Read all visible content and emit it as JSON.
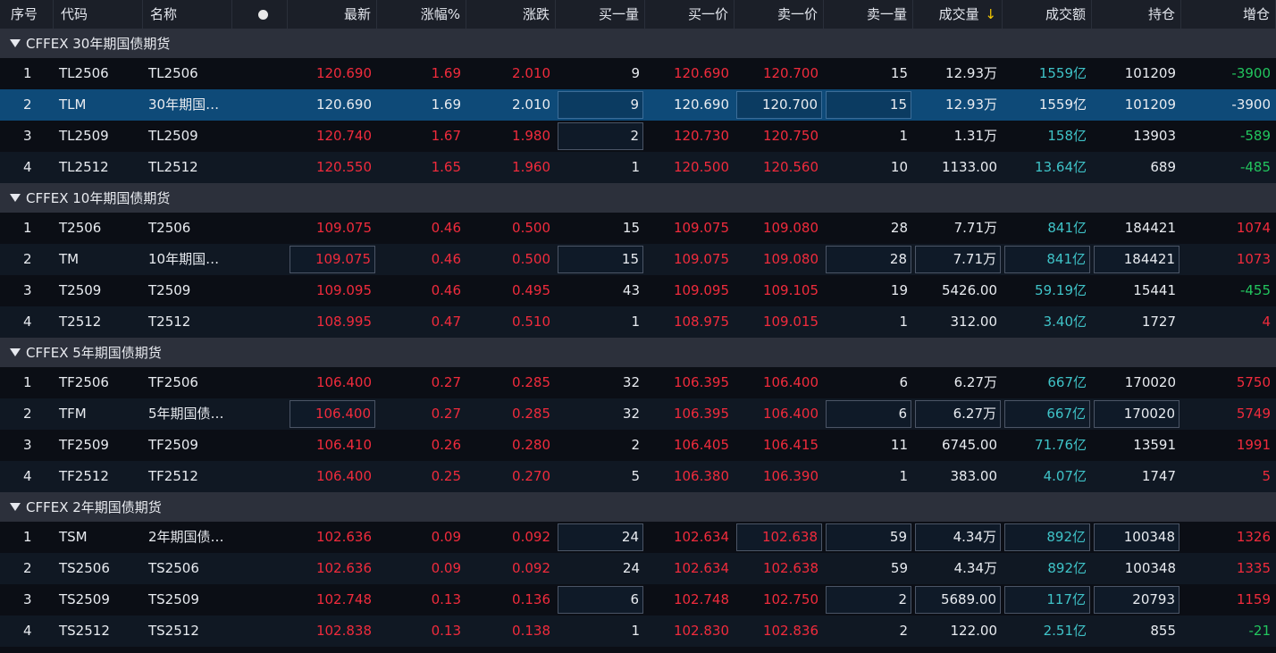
{
  "columns": [
    "序号",
    "代码",
    "名称",
    "",
    "最新",
    "涨幅%",
    "涨跌",
    "买一量",
    "买一价",
    "卖一价",
    "卖一量",
    "成交量",
    "成交额",
    "持仓",
    "增仓"
  ],
  "sort_indicator": "↓",
  "colors": {
    "up": "#f02b3c",
    "down": "#22c55e",
    "amount": "#3fc3c8",
    "selected": "#0e4a78"
  },
  "groups": [
    {
      "title": "CFFEX 30年期国债期货",
      "rows": [
        {
          "idx": "1",
          "code": "TL2506",
          "name": "TL2506",
          "last": "120.690",
          "pct": "1.69",
          "chg": "2.010",
          "bidv": "9",
          "bid": "120.690",
          "ask": "120.700",
          "askv": "15",
          "vol": "12.93万",
          "amt": "1559亿",
          "oi": "101209",
          "doi": "-3900",
          "doi_color": "green"
        },
        {
          "idx": "2",
          "code": "TLM",
          "name": "30年期国…",
          "last": "120.690",
          "pct": "1.69",
          "chg": "2.010",
          "bidv": "9",
          "bid": "120.690",
          "ask": "120.700",
          "askv": "15",
          "vol": "12.93万",
          "amt": "1559亿",
          "oi": "101209",
          "doi": "-3900",
          "doi_color": "white",
          "selected": true
        },
        {
          "idx": "3",
          "code": "TL2509",
          "name": "TL2509",
          "last": "120.740",
          "pct": "1.67",
          "chg": "1.980",
          "bidv": "2",
          "bid": "120.730",
          "ask": "120.750",
          "askv": "1",
          "vol": "1.31万",
          "amt": "158亿",
          "oi": "13903",
          "doi": "-589",
          "doi_color": "green"
        },
        {
          "idx": "4",
          "code": "TL2512",
          "name": "TL2512",
          "last": "120.550",
          "pct": "1.65",
          "chg": "1.960",
          "bidv": "1",
          "bid": "120.500",
          "ask": "120.560",
          "askv": "10",
          "vol": "1133.00",
          "amt": "13.64亿",
          "oi": "689",
          "doi": "-485",
          "doi_color": "green"
        }
      ]
    },
    {
      "title": "CFFEX 10年期国债期货",
      "rows": [
        {
          "idx": "1",
          "code": "T2506",
          "name": "T2506",
          "last": "109.075",
          "pct": "0.46",
          "chg": "0.500",
          "bidv": "15",
          "bid": "109.075",
          "ask": "109.080",
          "askv": "28",
          "vol": "7.71万",
          "amt": "841亿",
          "oi": "184421",
          "doi": "1074",
          "doi_color": "red"
        },
        {
          "idx": "2",
          "code": "TM",
          "name": "10年期国…",
          "last": "109.075",
          "pct": "0.46",
          "chg": "0.500",
          "bidv": "15",
          "bid": "109.075",
          "ask": "109.080",
          "askv": "28",
          "vol": "7.71万",
          "amt": "841亿",
          "oi": "184421",
          "doi": "1073",
          "doi_color": "red"
        },
        {
          "idx": "3",
          "code": "T2509",
          "name": "T2509",
          "last": "109.095",
          "pct": "0.46",
          "chg": "0.495",
          "bidv": "43",
          "bid": "109.095",
          "ask": "109.105",
          "askv": "19",
          "vol": "5426.00",
          "amt": "59.19亿",
          "oi": "15441",
          "doi": "-455",
          "doi_color": "green"
        },
        {
          "idx": "4",
          "code": "T2512",
          "name": "T2512",
          "last": "108.995",
          "pct": "0.47",
          "chg": "0.510",
          "bidv": "1",
          "bid": "108.975",
          "ask": "109.015",
          "askv": "1",
          "vol": "312.00",
          "amt": "3.40亿",
          "oi": "1727",
          "doi": "4",
          "doi_color": "red"
        }
      ]
    },
    {
      "title": "CFFEX 5年期国债期货",
      "rows": [
        {
          "idx": "1",
          "code": "TF2506",
          "name": "TF2506",
          "last": "106.400",
          "pct": "0.27",
          "chg": "0.285",
          "bidv": "32",
          "bid": "106.395",
          "ask": "106.400",
          "askv": "6",
          "vol": "6.27万",
          "amt": "667亿",
          "oi": "170020",
          "doi": "5750",
          "doi_color": "red"
        },
        {
          "idx": "2",
          "code": "TFM",
          "name": "5年期国债…",
          "last": "106.400",
          "pct": "0.27",
          "chg": "0.285",
          "bidv": "32",
          "bid": "106.395",
          "ask": "106.400",
          "askv": "6",
          "vol": "6.27万",
          "amt": "667亿",
          "oi": "170020",
          "doi": "5749",
          "doi_color": "red"
        },
        {
          "idx": "3",
          "code": "TF2509",
          "name": "TF2509",
          "last": "106.410",
          "pct": "0.26",
          "chg": "0.280",
          "bidv": "2",
          "bid": "106.405",
          "ask": "106.415",
          "askv": "11",
          "vol": "6745.00",
          "amt": "71.76亿",
          "oi": "13591",
          "doi": "1991",
          "doi_color": "red"
        },
        {
          "idx": "4",
          "code": "TF2512",
          "name": "TF2512",
          "last": "106.400",
          "pct": "0.25",
          "chg": "0.270",
          "bidv": "5",
          "bid": "106.380",
          "ask": "106.390",
          "askv": "1",
          "vol": "383.00",
          "amt": "4.07亿",
          "oi": "1747",
          "doi": "5",
          "doi_color": "red"
        }
      ]
    },
    {
      "title": "CFFEX 2年期国债期货",
      "rows": [
        {
          "idx": "1",
          "code": "TSM",
          "name": "2年期国债…",
          "last": "102.636",
          "pct": "0.09",
          "chg": "0.092",
          "bidv": "24",
          "bid": "102.634",
          "ask": "102.638",
          "askv": "59",
          "vol": "4.34万",
          "amt": "892亿",
          "oi": "100348",
          "doi": "1326",
          "doi_color": "red"
        },
        {
          "idx": "2",
          "code": "TS2506",
          "name": "TS2506",
          "last": "102.636",
          "pct": "0.09",
          "chg": "0.092",
          "bidv": "24",
          "bid": "102.634",
          "ask": "102.638",
          "askv": "59",
          "vol": "4.34万",
          "amt": "892亿",
          "oi": "100348",
          "doi": "1335",
          "doi_color": "red"
        },
        {
          "idx": "3",
          "code": "TS2509",
          "name": "TS2509",
          "last": "102.748",
          "pct": "0.13",
          "chg": "0.136",
          "bidv": "6",
          "bid": "102.748",
          "ask": "102.750",
          "askv": "2",
          "vol": "5689.00",
          "amt": "117亿",
          "oi": "20793",
          "doi": "1159",
          "doi_color": "red"
        },
        {
          "idx": "4",
          "code": "TS2512",
          "name": "TS2512",
          "last": "102.838",
          "pct": "0.13",
          "chg": "0.138",
          "bidv": "1",
          "bid": "102.830",
          "ask": "102.836",
          "askv": "2",
          "vol": "122.00",
          "amt": "2.51亿",
          "oi": "855",
          "doi": "-21",
          "doi_color": "green"
        }
      ]
    }
  ]
}
